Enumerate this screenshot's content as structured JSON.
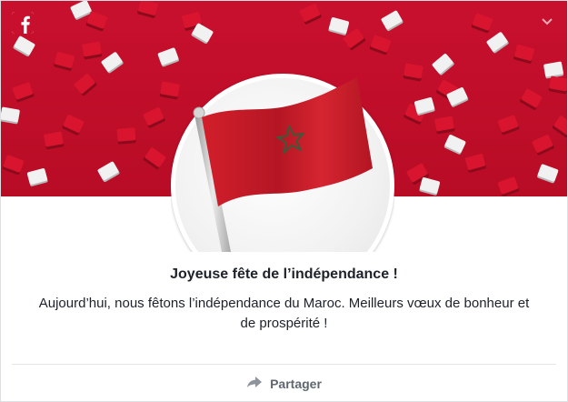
{
  "card": {
    "title": "Joyeuse fête de l’indépendance !",
    "message": "Aujourd’hui, nous fêtons l’indépendance du Maroc. Meilleurs vœux de bonheur et de prospérité !",
    "share_label": "Partager"
  },
  "icons": {
    "brand": "facebook-icon",
    "menu": "chevron-down-icon",
    "illustration": "morocco-flag-icon",
    "share": "share-arrow-icon"
  },
  "colors": {
    "banner_red": "#c8102e",
    "flag_red": "#c1272d",
    "star_green": "#006233",
    "text": "#1d2129",
    "muted": "#606770"
  }
}
